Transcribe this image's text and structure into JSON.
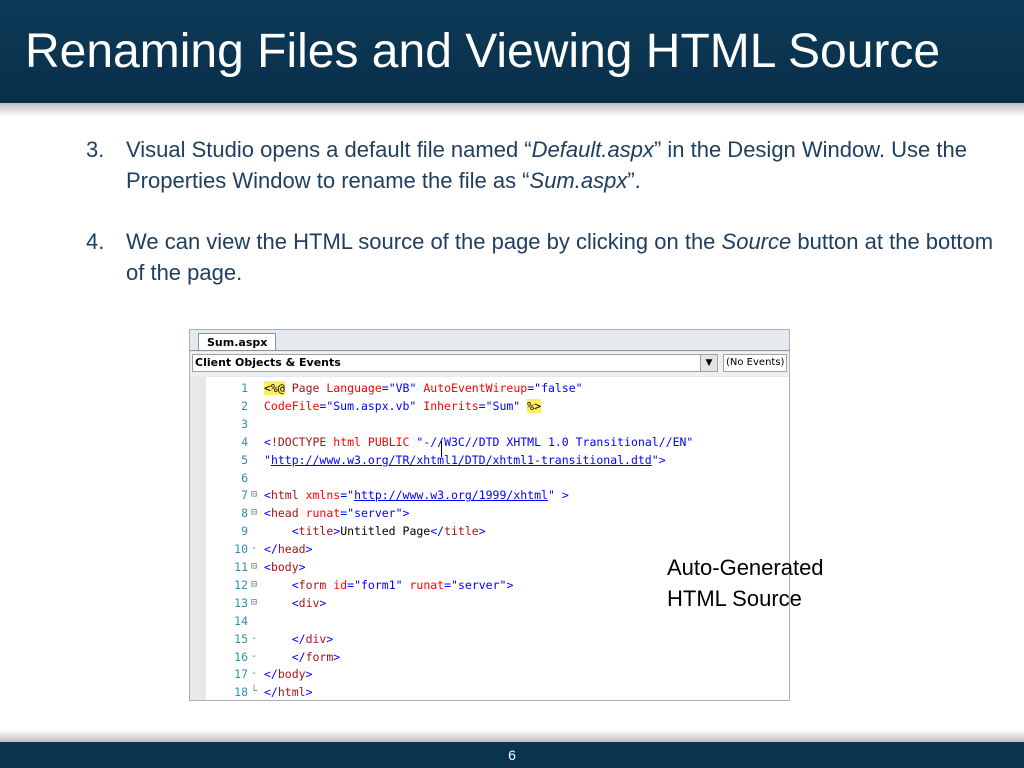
{
  "slide": {
    "title": "Renaming Files and Viewing HTML Source",
    "page_number": "6"
  },
  "bullets": [
    {
      "num": "3.",
      "t1": "Visual Studio opens a default file named “",
      "i1": "Default.aspx",
      "t2": "” in the Design Window. Use the Properties Window to rename the file as “",
      "i2": "Sum.aspx",
      "t3": "”."
    },
    {
      "num": "4.",
      "t1": "We can view the HTML source of the page by clicking on the ",
      "i1": "Source",
      "t2": " button at the bottom of the page."
    }
  ],
  "editor": {
    "tab_label": "Sum.aspx",
    "objects_combo": "Client Objects & Events",
    "events_combo": "(No Events)",
    "lines": [
      {
        "n": "1",
        "fold": "",
        "segs": [
          [
            "dir",
            "<%"
          ],
          [
            "dir",
            "@"
          ],
          [
            "text",
            " "
          ],
          [
            "tag",
            "Page"
          ],
          [
            "text",
            " "
          ],
          [
            "attr",
            "Language"
          ],
          [
            "delim",
            "="
          ],
          [
            "val",
            "\"VB\""
          ],
          [
            "text",
            " "
          ],
          [
            "attr",
            "AutoEventWireup"
          ],
          [
            "delim",
            "="
          ],
          [
            "val",
            "\"false\""
          ]
        ]
      },
      {
        "n": "2",
        "fold": "",
        "segs": [
          [
            "attr",
            "CodeFile"
          ],
          [
            "delim",
            "="
          ],
          [
            "val",
            "\"Sum.aspx.vb\""
          ],
          [
            "text",
            " "
          ],
          [
            "attr",
            "Inherits"
          ],
          [
            "delim",
            "="
          ],
          [
            "val",
            "\"Sum\""
          ],
          [
            "text",
            " "
          ],
          [
            "dir",
            "%>"
          ]
        ]
      },
      {
        "n": "3",
        "fold": "",
        "segs": []
      },
      {
        "n": "4",
        "fold": "",
        "segs": [
          [
            "delim",
            "<"
          ],
          [
            "tag",
            "!DOCTYPE"
          ],
          [
            "text",
            " "
          ],
          [
            "attr",
            "html"
          ],
          [
            "text",
            " "
          ],
          [
            "attr",
            "PUBLIC"
          ],
          [
            "text",
            " "
          ],
          [
            "val",
            "\"-//W3C//DTD XHTML 1.0 Transitional//EN\""
          ]
        ]
      },
      {
        "n": "5",
        "fold": "",
        "segs": [
          [
            "val",
            "\""
          ],
          [
            "url",
            "http://www.w3.org/TR/xhtml1/DTD/xhtml1-transitional.dtd"
          ],
          [
            "val",
            "\""
          ],
          [
            "delim",
            ">"
          ]
        ]
      },
      {
        "n": "6",
        "fold": "",
        "segs": []
      },
      {
        "n": "7",
        "fold": "⊟",
        "segs": [
          [
            "delim",
            "<"
          ],
          [
            "tag",
            "html"
          ],
          [
            "text",
            " "
          ],
          [
            "attr",
            "xmlns"
          ],
          [
            "delim",
            "="
          ],
          [
            "val",
            "\""
          ],
          [
            "url",
            "http://www.w3.org/1999/xhtml"
          ],
          [
            "val",
            "\""
          ],
          [
            "text",
            " "
          ],
          [
            "delim",
            ">"
          ]
        ]
      },
      {
        "n": "8",
        "fold": "⊟",
        "segs": [
          [
            "delim",
            "<"
          ],
          [
            "tag",
            "head"
          ],
          [
            "text",
            " "
          ],
          [
            "attr",
            "runat"
          ],
          [
            "delim",
            "="
          ],
          [
            "val",
            "\"server\""
          ],
          [
            "delim",
            ">"
          ]
        ]
      },
      {
        "n": "9",
        "fold": "",
        "segs": [
          [
            "text",
            "    "
          ],
          [
            "delim",
            "<"
          ],
          [
            "tag",
            "title"
          ],
          [
            "delim",
            ">"
          ],
          [
            "text",
            "Untitled Page"
          ],
          [
            "delim",
            "</"
          ],
          [
            "tag",
            "title"
          ],
          [
            "delim",
            ">"
          ]
        ]
      },
      {
        "n": "10",
        "fold": "-",
        "segs": [
          [
            "delim",
            "</"
          ],
          [
            "tag",
            "head"
          ],
          [
            "delim",
            ">"
          ]
        ]
      },
      {
        "n": "11",
        "fold": "⊟",
        "segs": [
          [
            "delim",
            "<"
          ],
          [
            "tag",
            "body"
          ],
          [
            "delim",
            ">"
          ]
        ]
      },
      {
        "n": "12",
        "fold": "⊟",
        "segs": [
          [
            "text",
            "    "
          ],
          [
            "delim",
            "<"
          ],
          [
            "tag",
            "form"
          ],
          [
            "text",
            " "
          ],
          [
            "attr",
            "id"
          ],
          [
            "delim",
            "="
          ],
          [
            "val",
            "\"form1\""
          ],
          [
            "text",
            " "
          ],
          [
            "attr",
            "runat"
          ],
          [
            "delim",
            "="
          ],
          [
            "val",
            "\"server\""
          ],
          [
            "delim",
            ">"
          ]
        ]
      },
      {
        "n": "13",
        "fold": "⊟",
        "segs": [
          [
            "text",
            "    "
          ],
          [
            "delim",
            "<"
          ],
          [
            "tag",
            "div"
          ],
          [
            "delim",
            ">"
          ]
        ]
      },
      {
        "n": "14",
        "fold": "",
        "segs": []
      },
      {
        "n": "15",
        "fold": "-",
        "segs": [
          [
            "text",
            "    "
          ],
          [
            "delim",
            "</"
          ],
          [
            "tag",
            "div"
          ],
          [
            "delim",
            ">"
          ]
        ]
      },
      {
        "n": "16",
        "fold": "-",
        "segs": [
          [
            "text",
            "    "
          ],
          [
            "delim",
            "</"
          ],
          [
            "tag",
            "form"
          ],
          [
            "delim",
            ">"
          ]
        ]
      },
      {
        "n": "17",
        "fold": "-",
        "segs": [
          [
            "delim",
            "</"
          ],
          [
            "tag",
            "body"
          ],
          [
            "delim",
            ">"
          ]
        ]
      },
      {
        "n": "18",
        "fold": "└",
        "segs": [
          [
            "delim",
            "</"
          ],
          [
            "tag",
            "html"
          ],
          [
            "delim",
            ">"
          ]
        ]
      }
    ]
  },
  "caption": {
    "line1": "Auto-Generated",
    "line2": "HTML Source"
  }
}
